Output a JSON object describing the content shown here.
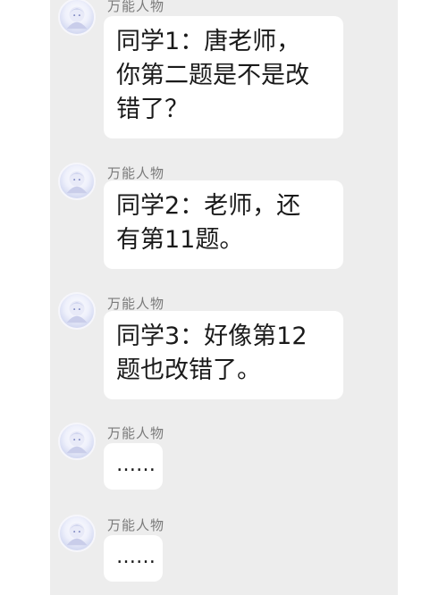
{
  "messages": [
    {
      "sender": "万能人物",
      "avatar_icon": "anime-girl-avatar-icon",
      "text": "同学1：唐老师，\n你第二题是不是改\n错了？"
    },
    {
      "sender": "万能人物",
      "avatar_icon": "anime-girl-avatar-icon",
      "text": "同学2：老师，还\n有第11题。"
    },
    {
      "sender": "万能人物",
      "avatar_icon": "anime-girl-avatar-icon",
      "text": "同学3：好像第12\n题也改错了。"
    },
    {
      "sender": "万能人物",
      "avatar_icon": "anime-girl-avatar-icon",
      "text": "……"
    },
    {
      "sender": "万能人物",
      "avatar_icon": "anime-girl-avatar-icon",
      "text": "……"
    }
  ],
  "colors": {
    "chat_background": "#ededed",
    "bubble": "#ffffff",
    "sender_text": "#7a7a7a"
  }
}
